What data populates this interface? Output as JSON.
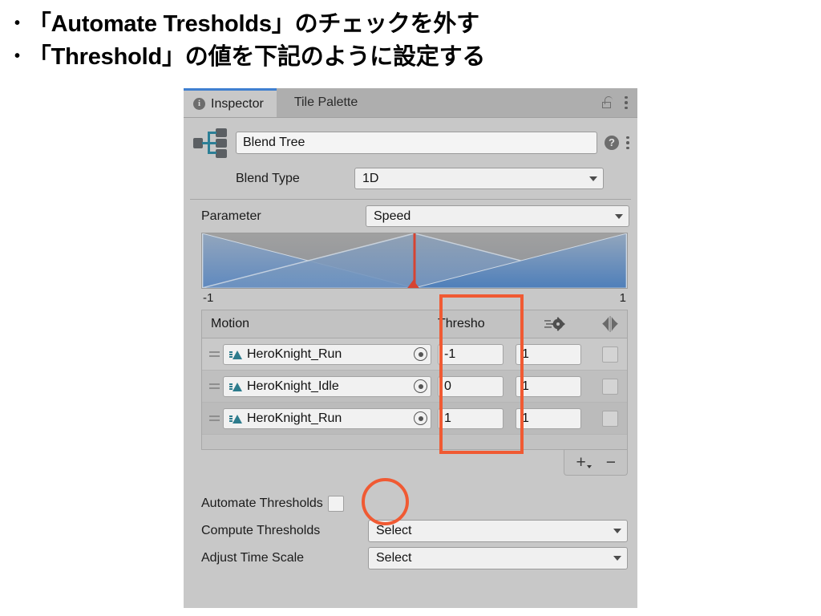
{
  "slide": {
    "bullets": [
      {
        "marker": "•",
        "text": "「Automate Tresholds」のチェックを外す"
      },
      {
        "marker": "•",
        "text": "「Threshold」の値を下記のように設定する"
      }
    ]
  },
  "inspector": {
    "tabs": [
      {
        "label": "Inspector",
        "icon": "info-icon",
        "active": true
      },
      {
        "label": "Tile Palette",
        "icon": null,
        "active": false
      }
    ],
    "lock_icon": "lock-open-icon",
    "menu_icon": "kebab-menu-icon",
    "asset": {
      "icon": "blend-tree-icon",
      "name": "Blend Tree",
      "help_icon": "help-icon",
      "menu_icon": "kebab-menu-icon"
    },
    "blend_type": {
      "label": "Blend Type",
      "value": "1D"
    },
    "parameter": {
      "label": "Parameter",
      "value": "Speed"
    },
    "graph": {
      "axis_min": "-1",
      "axis_max": "1",
      "playhead_position_pct": 50
    },
    "table": {
      "headers": {
        "motion": "Motion",
        "threshold": "Thresho",
        "speed_icon": "speed-gear-icon",
        "mirror_icon": "mirror-icon"
      },
      "rows": [
        {
          "motion": "HeroKnight_Run",
          "threshold": "-1",
          "speed": "1",
          "mirror": false
        },
        {
          "motion": "HeroKnight_Idle",
          "threshold": "0",
          "speed": "1",
          "mirror": false
        },
        {
          "motion": "HeroKnight_Run",
          "threshold": "1",
          "speed": "1",
          "mirror": false
        }
      ],
      "add_button": "+",
      "remove_button": "−"
    },
    "options": {
      "automate_thresholds": {
        "label": "Automate Thresholds",
        "checked": false
      },
      "compute_thresholds": {
        "label": "Compute Thresholds",
        "value": "Select"
      },
      "adjust_time_scale": {
        "label": "Adjust Time Scale",
        "value": "Select"
      }
    }
  },
  "annotations": {
    "color": "#f05a33",
    "threshold_column_highlight": "rectangle around Threshold column",
    "automate_checkbox_highlight": "circle around Automate Thresholds checkbox"
  }
}
